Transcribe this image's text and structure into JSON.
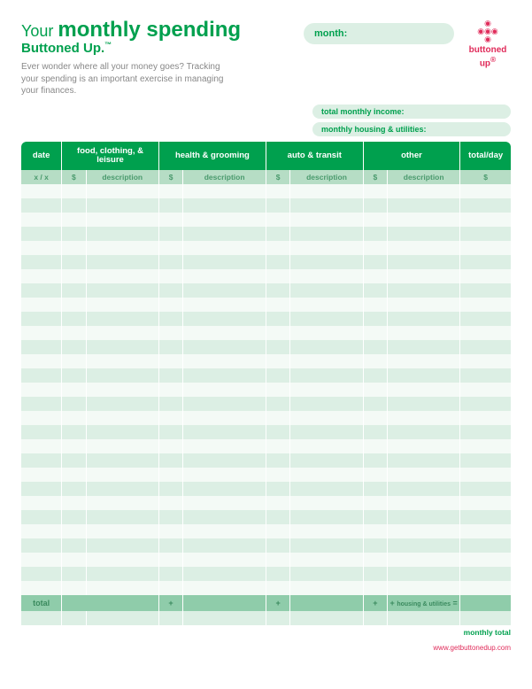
{
  "header": {
    "title_prefix": "Your",
    "title_main": "monthly spending",
    "subtitle": "Buttoned Up.",
    "tm": "™",
    "intro": "Ever wonder where all your money goes? Tracking your spending is an important exercise in managing your finances.",
    "month_label": "month:",
    "logo_text": "buttoned up",
    "logo_reg": "®"
  },
  "pills": {
    "income": "total monthly income:",
    "housing": "monthly housing & utilities:"
  },
  "columns": {
    "date": "date",
    "food": "food, clothing, & leisure",
    "health": "health & grooming",
    "auto": "auto & transit",
    "other": "other",
    "total": "total/day"
  },
  "subheaders": {
    "date": "x / x",
    "amount": "$",
    "description": "description"
  },
  "totals": {
    "label": "total",
    "plus": "+",
    "housing_util": "housing & utilities",
    "equals": "="
  },
  "footer": {
    "monthly_total": "monthly total",
    "url": "www.getbuttonedup.com"
  },
  "row_count": 29,
  "chart_data": {
    "type": "table",
    "title": "Monthly Spending Tracker",
    "columns": [
      "date",
      "food/clothing/leisure $",
      "food/clothing/leisure description",
      "health & grooming $",
      "health & grooming description",
      "auto & transit $",
      "auto & transit description",
      "other $",
      "other description",
      "total/day"
    ],
    "rows": []
  }
}
